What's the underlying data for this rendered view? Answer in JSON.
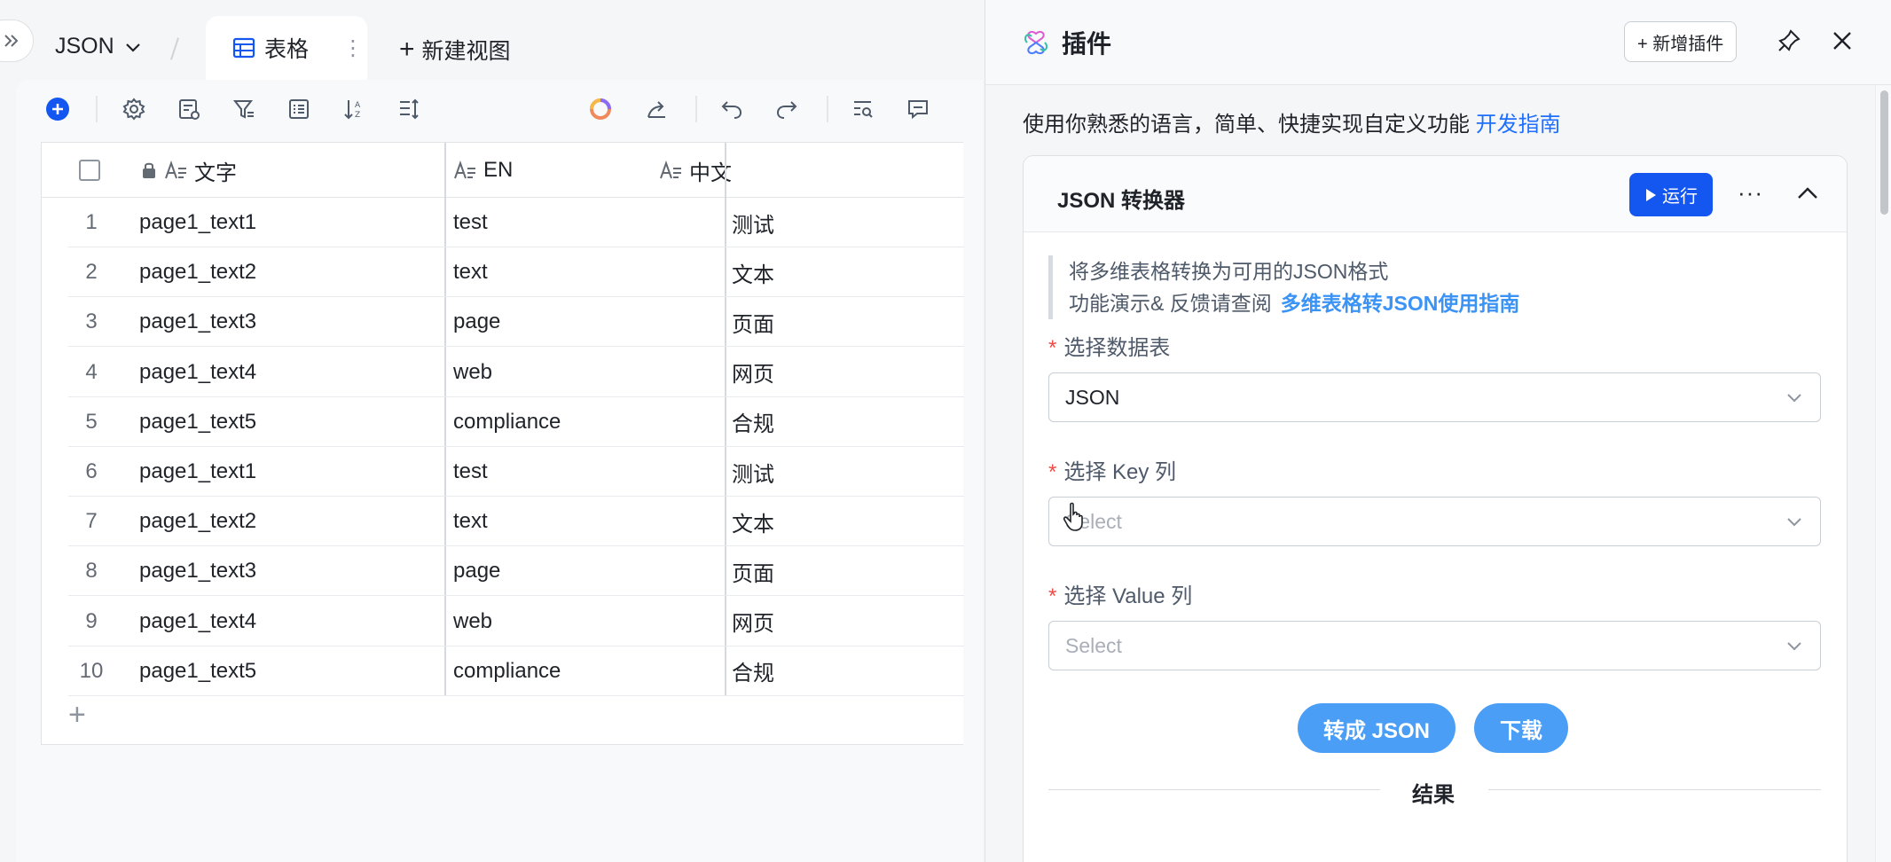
{
  "left": {
    "breadcrumb": {
      "base_name": "JSON"
    },
    "active_tab": {
      "label": "表格"
    },
    "new_view_label": "新建视图",
    "table": {
      "headers": {
        "text_col": "文字",
        "en_col": "EN",
        "zh_col": "中文"
      },
      "rows": [
        {
          "no": "1",
          "text": "page1_text1",
          "en": "test",
          "zh": "测试"
        },
        {
          "no": "2",
          "text": "page1_text2",
          "en": "text",
          "zh": "文本"
        },
        {
          "no": "3",
          "text": "page1_text3",
          "en": "page",
          "zh": "页面"
        },
        {
          "no": "4",
          "text": "page1_text4",
          "en": "web",
          "zh": "网页"
        },
        {
          "no": "5",
          "text": "page1_text5",
          "en": "compliance",
          "zh": "合规"
        },
        {
          "no": "6",
          "text": "page1_text1",
          "en": "test",
          "zh": "测试"
        },
        {
          "no": "7",
          "text": "page1_text2",
          "en": "text",
          "zh": "文本"
        },
        {
          "no": "8",
          "text": "page1_text3",
          "en": "page",
          "zh": "页面"
        },
        {
          "no": "9",
          "text": "page1_text4",
          "en": "web",
          "zh": "网页"
        },
        {
          "no": "10",
          "text": "page1_text5",
          "en": "compliance",
          "zh": "合规"
        }
      ]
    }
  },
  "right": {
    "title": "插件",
    "add_plugin_label": "+ 新增插件",
    "description": "使用你熟悉的语言，简单、快捷实现自定义功能",
    "dev_guide_link": "开发指南",
    "plugin": {
      "name": "JSON 转换器",
      "run_label": "运行",
      "note_line1": "将多维表格转换为可用的JSON格式",
      "note_line2": "功能演示& 反馈请查阅",
      "note_link": "多维表格转JSON使用指南",
      "field_table_label": "选择数据表",
      "field_table_value": "JSON",
      "field_key_label": "选择 Key 列",
      "field_key_placeholder": "Select",
      "field_value_label": "选择 Value 列",
      "field_value_placeholder": "Select",
      "convert_label": "转成 JSON",
      "download_label": "下载",
      "result_label": "结果"
    }
  },
  "colors": {
    "primary": "#1456f0",
    "pill": "#4a9ef5",
    "link": "#1e6fff",
    "required": "#f54a45"
  }
}
